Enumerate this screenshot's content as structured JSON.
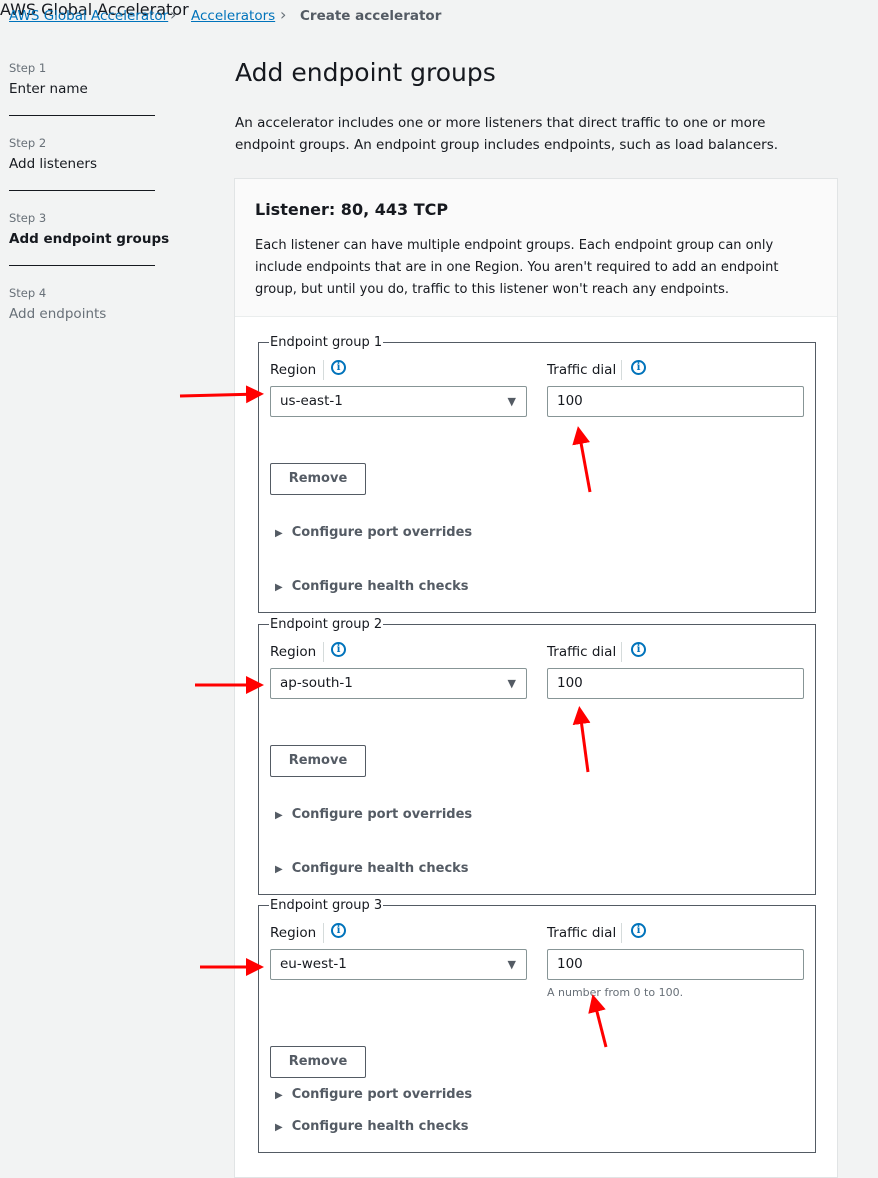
{
  "breadcrumb": [
    "AWS Global Accelerator",
    "Accelerators",
    "Create accelerator"
  ],
  "steps": [
    {
      "label": "Step 1",
      "name": "Enter name"
    },
    {
      "label": "Step 2",
      "name": "Add listeners"
    },
    {
      "label": "Step 3",
      "name": "Add endpoint groups"
    },
    {
      "label": "Step 4",
      "name": "Add endpoints"
    }
  ],
  "page": {
    "title": "Add endpoint groups",
    "intro": "An accelerator includes one or more listeners that direct traffic to one or more endpoint groups. An endpoint group includes endpoints, such as load balancers."
  },
  "listener": {
    "title": "Listener: 80, 443 TCP",
    "description": "Each listener can have multiple endpoint groups. Each endpoint group can only include endpoints that are in one Region. You aren't required to add an endpoint group, but until you do, traffic to this listener won't reach any endpoints."
  },
  "labels": {
    "region": "Region",
    "traffic_dial": "Traffic dial",
    "remove": "Remove",
    "port_overrides": "Configure port overrides",
    "health_checks": "Configure health checks",
    "info": "i"
  },
  "groups": [
    {
      "legend": "Endpoint group 1",
      "region": "us-east-1",
      "traffic_dial": "100"
    },
    {
      "legend": "Endpoint group 2",
      "region": "ap-south-1",
      "traffic_dial": "100"
    },
    {
      "legend": "Endpoint group 3",
      "region": "eu-west-1",
      "traffic_dial": "100",
      "hint": "A number from 0 to 100."
    }
  ],
  "colors": {
    "annotation_arrow": "#ff0000",
    "link": "#0073bb"
  }
}
